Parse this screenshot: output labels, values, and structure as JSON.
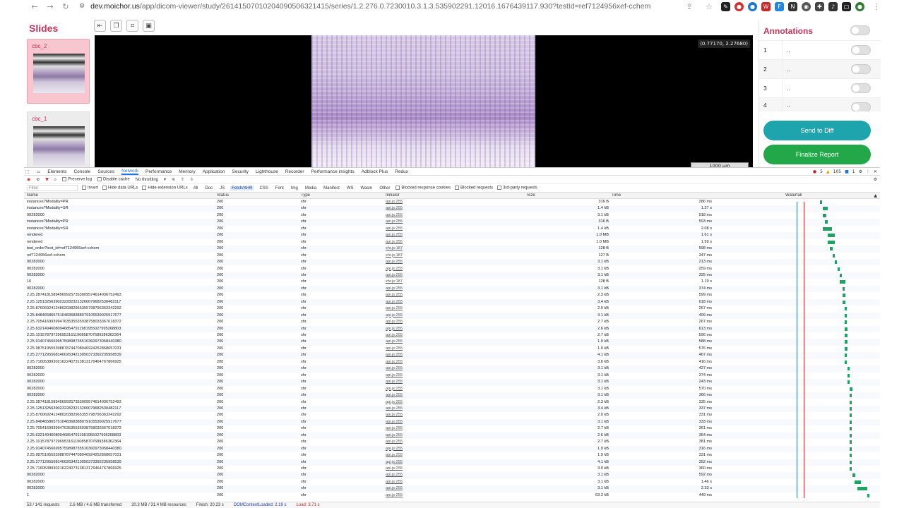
{
  "browser": {
    "url_host": "dev.moichor.us",
    "url_path": "/app/dicom-viewer/study/26141507010204090506321415/series/1.2.276.0.7230010.3.1.3.535902291.12016.1676439117.930?testId=ref7124956xef-cchem"
  },
  "slides_panel": {
    "title": "Slides",
    "items": [
      {
        "label": "cbc_2",
        "active": true
      },
      {
        "label": "cbc_1",
        "active": false
      }
    ]
  },
  "viewer": {
    "coordinate_readout": "(0.77170, 2.27680)",
    "scale_bar": "1000 µm"
  },
  "annotations": {
    "title": "Annotations",
    "rows": [
      {
        "num": "1",
        "desc": ".."
      },
      {
        "num": "2",
        "desc": ".."
      },
      {
        "num": "3",
        "desc": ".."
      },
      {
        "num": "4",
        "desc": ".."
      }
    ],
    "send_label": "Send to Diff",
    "finalize_label": "Finalize Report",
    "send_color": "#1ea4ad",
    "finalize_color": "#23a849"
  },
  "devtools": {
    "tabs": [
      "Elements",
      "Console",
      "Sources",
      "Network",
      "Performance",
      "Memory",
      "Application",
      "Security",
      "Lighthouse",
      "Recorder",
      "Performance insights",
      "Adblock Plus",
      "Redux"
    ],
    "active_tab": "Network",
    "badges": {
      "errors": "5",
      "warnings": "105",
      "info": "1"
    },
    "toolbar1": {
      "preserve_log": "Preserve log",
      "disable_cache": "Disable cache",
      "throttling": "No throttling"
    },
    "toolbar2": {
      "filter_placeholder": "Filter",
      "invert": "Invert",
      "hide_data": "Hide data URLs",
      "hide_ext": "Hide extension URLs",
      "types": [
        "All",
        "Doc",
        "JS",
        "Fetch/XHR",
        "CSS",
        "Font",
        "Img",
        "Media",
        "Manifest",
        "WS",
        "Wasm",
        "Other"
      ],
      "active_type": "Fetch/XHR",
      "blocked_cookies": "Blocked response cookies",
      "blocked_requests": "Blocked requests",
      "third_party": "3rd-party requests"
    },
    "columns": [
      "Name",
      "Status",
      "Type",
      "Initiator",
      "Size",
      "Time",
      "Waterfall"
    ],
    "requests": [
      {
        "name": "instances?Modality=PR",
        "status": "200",
        "type": "xhr",
        "initiator": "api.js:255",
        "size": "316 B",
        "time": "286 ms",
        "wf": [
          0.14,
          0.04
        ]
      },
      {
        "name": "instances?Modality=SR",
        "status": "200",
        "type": "xhr",
        "initiator": "api.js:255",
        "size": "1.4 kB",
        "time": "1.27 s",
        "wf": [
          0.15,
          0.12
        ]
      },
      {
        "name": "00282000",
        "status": "200",
        "type": "xhr",
        "initiator": "api.js:255",
        "size": "3.1 kB",
        "time": "918 ms",
        "wf": [
          0.15,
          0.09
        ]
      },
      {
        "name": "instances?Modality=PR",
        "status": "200",
        "type": "xhr",
        "initiator": "api.js:255",
        "size": "316 B",
        "time": "593 ms",
        "wf": [
          0.16,
          0.06
        ]
      },
      {
        "name": "instances?Modality=SR",
        "status": "200",
        "type": "xhr",
        "initiator": "api.js:255",
        "size": "1.4 kB",
        "time": "2.08 s",
        "wf": [
          0.15,
          0.2
        ]
      },
      {
        "name": "rendered",
        "status": "200",
        "type": "xhr",
        "initiator": "api.js:255",
        "size": "1.0 MB",
        "time": "1.61 s",
        "wf": [
          0.17,
          0.16
        ]
      },
      {
        "name": "rendered",
        "status": "200",
        "type": "xhr",
        "initiator": "api.js:255",
        "size": "1.0 MB",
        "time": "1.59 s",
        "wf": [
          0.17,
          0.16
        ]
      },
      {
        "name": "test_order?test_id=ref7124956xef-cchem",
        "status": "200",
        "type": "xhr",
        "initiator": "xhr.js:187",
        "size": "128 B",
        "time": "598 ms",
        "wf": [
          0.18,
          0.06
        ]
      },
      {
        "name": "ref7124956xef-cchem",
        "status": "200",
        "type": "xhr",
        "initiator": "xhr.js:187",
        "size": "127 B",
        "time": "347 ms",
        "wf": [
          0.19,
          0.04
        ]
      },
      {
        "name": "00282000",
        "status": "200",
        "type": "xhr",
        "initiator": "api.js:255",
        "size": "3.1 kB",
        "time": "213 ms",
        "wf": [
          0.2,
          0.03
        ]
      },
      {
        "name": "00282000",
        "status": "200",
        "type": "xhr",
        "initiator": "api.js:255",
        "size": "3.1 kB",
        "time": "259 ms",
        "wf": [
          0.21,
          0.03
        ]
      },
      {
        "name": "00282000",
        "status": "200",
        "type": "xhr",
        "initiator": "api.js:255",
        "size": "3.1 kB",
        "time": "325 ms",
        "wf": [
          0.22,
          0.03
        ]
      },
      {
        "name": "16",
        "status": "200",
        "type": "xhr",
        "initiator": "xhr.js:187",
        "size": "128 B",
        "time": "1.19 s",
        "wf": [
          0.22,
          0.12
        ]
      },
      {
        "name": "00282000",
        "status": "200",
        "type": "xhr",
        "initiator": "api.js:255",
        "size": "3.1 kB",
        "time": "374 ms",
        "wf": [
          0.23,
          0.04
        ]
      },
      {
        "name": "2.25.287418158945699257353009574614036752493",
        "status": "200",
        "type": "xhr",
        "initiator": "api.js:255",
        "size": "2.3 kB",
        "time": "599 ms",
        "wf": [
          0.23,
          0.06
        ]
      },
      {
        "name": "2.25.125132563902322823213260079682530482117",
        "status": "200",
        "type": "xhr",
        "initiator": "api.js:255",
        "size": "3.4 kB",
        "time": "618 ms",
        "wf": [
          0.23,
          0.06
        ]
      },
      {
        "name": "2.25.876069241248020382965355798796363342292",
        "status": "200",
        "type": "xhr",
        "initiator": "api.js:255",
        "size": "2.0 kB",
        "time": "267 ms",
        "wf": [
          0.24,
          0.03
        ]
      },
      {
        "name": "2.25.848465865751048368388079105539025917677",
        "status": "200",
        "type": "xhr",
        "initiator": "api.js:255",
        "size": "3.1 kB",
        "time": "499 ms",
        "wf": [
          0.24,
          0.05
        ]
      },
      {
        "name": "2.25.705416993994763535535938758033367018372",
        "status": "200",
        "type": "xhr",
        "initiator": "api.js:255",
        "size": "2.7 kB",
        "time": "267 ms",
        "wf": [
          0.24,
          0.03
        ]
      },
      {
        "name": "2.25.632149460809468547911981955027995268803",
        "status": "200",
        "type": "xhr",
        "initiator": "api.js:255",
        "size": "2.6 kB",
        "time": "613 ms",
        "wf": [
          0.24,
          0.06
        ]
      },
      {
        "name": "2.25.101578797296953161190858707689386362364",
        "status": "200",
        "type": "xhr",
        "initiator": "api.js:255",
        "size": "2.7 kB",
        "time": "596 ms",
        "wf": [
          0.24,
          0.06
        ]
      },
      {
        "name": "2.25.914074566995759898735510360973058440380",
        "status": "200",
        "type": "xhr",
        "initiator": "api.js:255",
        "size": "1.9 kB",
        "time": "588 ms",
        "wf": [
          0.24,
          0.06
        ]
      },
      {
        "name": "2.25.987519555398878744708046924252868657031",
        "status": "200",
        "type": "xhr",
        "initiator": "api.js:255",
        "size": "1.9 kB",
        "time": "576 ms",
        "wf": [
          0.24,
          0.06
        ]
      },
      {
        "name": "2.25.277129556814002634213050373392235958539",
        "status": "200",
        "type": "xhr",
        "initiator": "api.js:255",
        "size": "4.1 kB",
        "time": "467 ms",
        "wf": [
          0.24,
          0.05
        ]
      },
      {
        "name": "2.25.716053893021622407313813176464767866925",
        "status": "200",
        "type": "xhr",
        "initiator": "api.js:255",
        "size": "3.0 kB",
        "time": "416 ms",
        "wf": [
          0.24,
          0.04
        ]
      },
      {
        "name": "00282000",
        "status": "200",
        "type": "xhr",
        "initiator": "api.js:255",
        "size": "3.1 kB",
        "time": "427 ms",
        "wf": [
          0.25,
          0.04
        ]
      },
      {
        "name": "00282000",
        "status": "200",
        "type": "xhr",
        "initiator": "api.js:255",
        "size": "3.1 kB",
        "time": "374 ms",
        "wf": [
          0.25,
          0.04
        ]
      },
      {
        "name": "00282000",
        "status": "200",
        "type": "xhr",
        "initiator": "api.js:255",
        "size": "3.1 kB",
        "time": "243 ms",
        "wf": [
          0.25,
          0.03
        ]
      },
      {
        "name": "00282000",
        "status": "200",
        "type": "xhr",
        "initiator": "api.js:255",
        "size": "3.1 kB",
        "time": "570 ms",
        "wf": [
          0.26,
          0.06
        ]
      },
      {
        "name": "00282000",
        "status": "200",
        "type": "xhr",
        "initiator": "api.js:255",
        "size": "3.1 kB",
        "time": "366 ms",
        "wf": [
          0.26,
          0.04
        ]
      },
      {
        "name": "2.25.287418158945699257353009574614036752493",
        "status": "200",
        "type": "xhr",
        "initiator": "api.js:255",
        "size": "2.3 kB",
        "time": "335 ms",
        "wf": [
          0.26,
          0.04
        ]
      },
      {
        "name": "2.25.125132563902322823213260079682530482117",
        "status": "200",
        "type": "xhr",
        "initiator": "api.js:255",
        "size": "3.4 kB",
        "time": "337 ms",
        "wf": [
          0.26,
          0.04
        ]
      },
      {
        "name": "2.25.876069241248020382965355798796363342292",
        "status": "200",
        "type": "xhr",
        "initiator": "api.js:255",
        "size": "2.0 kB",
        "time": "331 ms",
        "wf": [
          0.26,
          0.04
        ]
      },
      {
        "name": "2.25.848465865751048368388079105539025917677",
        "status": "200",
        "type": "xhr",
        "initiator": "api.js:255",
        "size": "3.1 kB",
        "time": "333 ms",
        "wf": [
          0.26,
          0.04
        ]
      },
      {
        "name": "2.25.705416993994763535535938758033367018372",
        "status": "200",
        "type": "xhr",
        "initiator": "api.js:255",
        "size": "2.7 kB",
        "time": "361 ms",
        "wf": [
          0.26,
          0.04
        ]
      },
      {
        "name": "2.25.632149460809468547911981955027995268803",
        "status": "200",
        "type": "xhr",
        "initiator": "api.js:255",
        "size": "2.6 kB",
        "time": "364 ms",
        "wf": [
          0.26,
          0.04
        ]
      },
      {
        "name": "2.25.101578797296953161190858707689386362364",
        "status": "200",
        "type": "xhr",
        "initiator": "api.js:255",
        "size": "2.7 kB",
        "time": "381 ms",
        "wf": [
          0.26,
          0.04
        ]
      },
      {
        "name": "2.25.914074566995759898735510360973058440380",
        "status": "200",
        "type": "xhr",
        "initiator": "api.js:255",
        "size": "1.9 kB",
        "time": "316 ms",
        "wf": [
          0.26,
          0.04
        ]
      },
      {
        "name": "2.25.987519555398878744708046924252868657031",
        "status": "200",
        "type": "xhr",
        "initiator": "api.js:255",
        "size": "1.9 kB",
        "time": "331 ms",
        "wf": [
          0.26,
          0.04
        ]
      },
      {
        "name": "2.25.277129556814002634213050373392235958539",
        "status": "200",
        "type": "xhr",
        "initiator": "api.js:255",
        "size": "4.1 kB",
        "time": "352 ms",
        "wf": [
          0.26,
          0.04
        ]
      },
      {
        "name": "2.25.716053893021622407313813176464767866925",
        "status": "200",
        "type": "xhr",
        "initiator": "api.js:255",
        "size": "3.0 kB",
        "time": "360 ms",
        "wf": [
          0.26,
          0.04
        ]
      },
      {
        "name": "00282000",
        "status": "200",
        "type": "xhr",
        "initiator": "api.js:255",
        "size": "3.1 kB",
        "time": "592 ms",
        "wf": [
          0.27,
          0.06
        ]
      },
      {
        "name": "00282000",
        "status": "200",
        "type": "xhr",
        "initiator": "api.js:255",
        "size": "3.1 kB",
        "time": "1.46 s",
        "wf": [
          0.28,
          0.14
        ]
      },
      {
        "name": "00282000",
        "status": "200",
        "type": "xhr",
        "initiator": "api.js:255",
        "size": "3.1 kB",
        "time": "2.33 s",
        "wf": [
          0.29,
          0.22
        ]
      },
      {
        "name": "1",
        "status": "200",
        "type": "xhr",
        "initiator": "api.js:255",
        "size": "63.3 kB",
        "time": "449 ms",
        "wf": [
          0.33,
          0.04
        ]
      }
    ],
    "status_bar": {
      "requests": "53 / 141 requests",
      "transferred": "2.6 MB / 4.6 MB transferred",
      "resources": "20.3 MB / 31.4 MB resources",
      "finish": "Finish: 20.23 s",
      "dcl": "DOMContentLoaded: 2.19 s",
      "load": "Load: 3.71 s"
    }
  }
}
